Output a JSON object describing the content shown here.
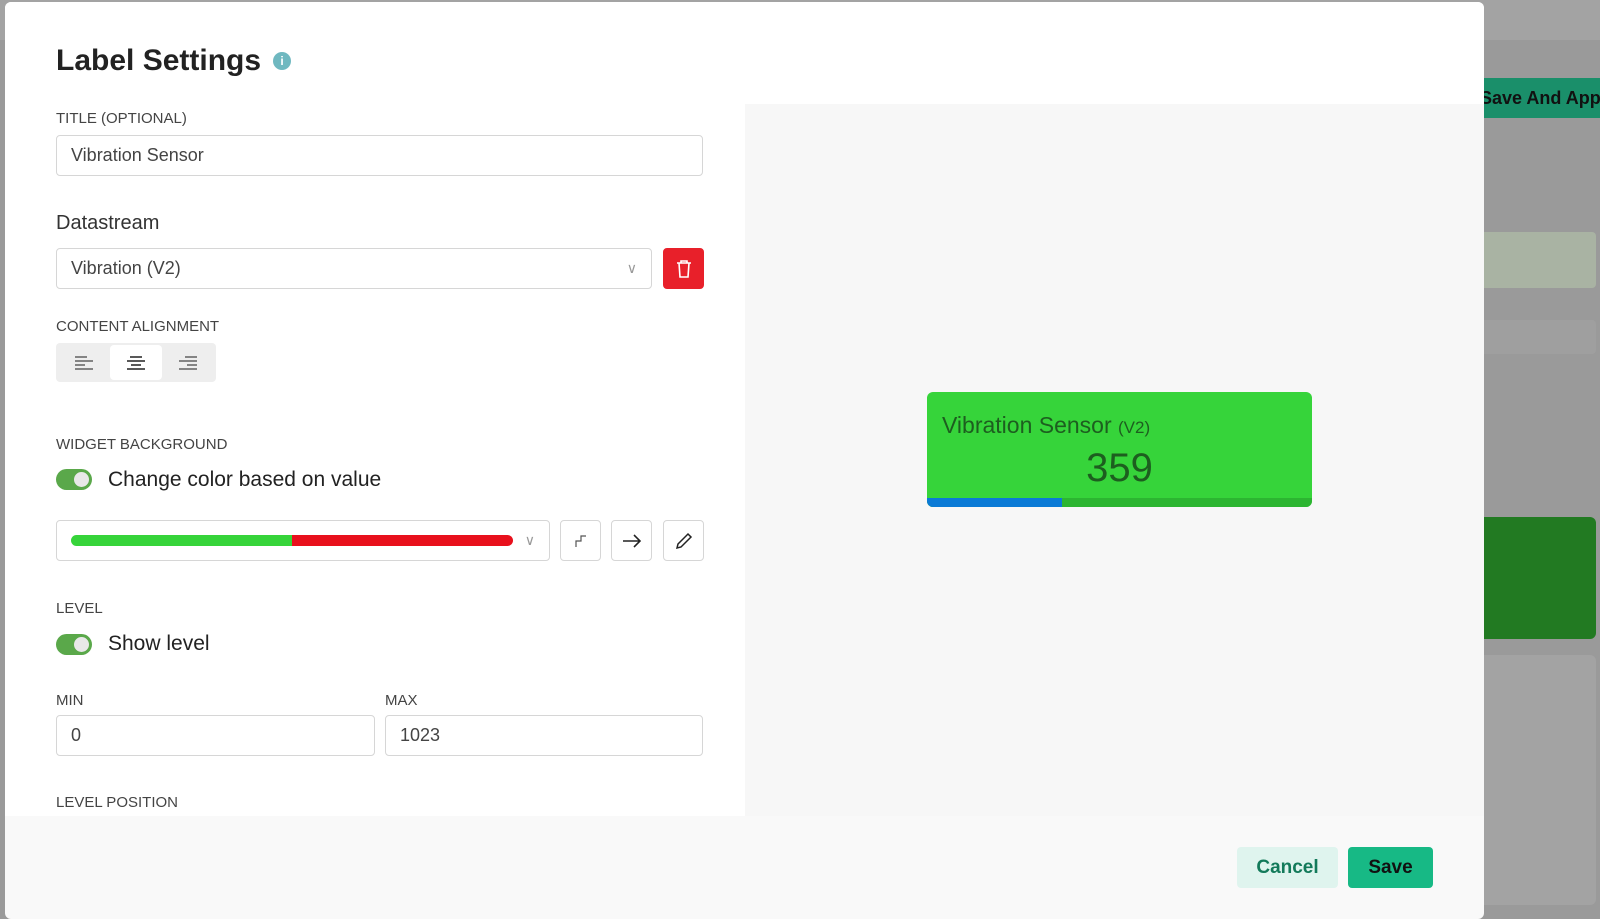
{
  "background": {
    "save_apply_label": "Save And Apply"
  },
  "dialog": {
    "title": "Label Settings",
    "info_icon": "info-icon",
    "title_field": {
      "label": "TITLE (OPTIONAL)",
      "value": "Vibration Sensor"
    },
    "datastream": {
      "label": "Datastream",
      "value": "Vibration (V2)"
    },
    "alignment": {
      "label": "CONTENT ALIGNMENT",
      "options": [
        "left",
        "center",
        "right"
      ],
      "selected": "center"
    },
    "widget_background": {
      "label": "WIDGET BACKGROUND",
      "toggle_label": "Change color based on value",
      "toggle_on": true,
      "gradient_colors": [
        "#36d43a",
        "#e8101c"
      ],
      "gradient_split_percent": 50
    },
    "level": {
      "label": "LEVEL",
      "toggle_label": "Show level",
      "toggle_on": true
    },
    "min": {
      "label": "MIN",
      "value": "0"
    },
    "max": {
      "label": "MAX",
      "value": "1023"
    },
    "level_position": {
      "label": "LEVEL POSITION"
    },
    "preview": {
      "title": "Vibration Sensor",
      "pin": "(V2)",
      "value": "359",
      "level_percent": 35,
      "bg_color": "#36d43a",
      "level_color": "#0a7ad6"
    },
    "cancel_label": "Cancel",
    "save_label": "Save"
  }
}
